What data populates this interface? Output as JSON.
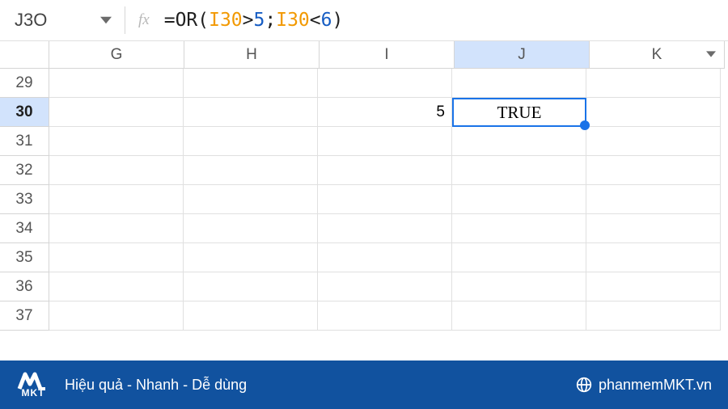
{
  "namebox": {
    "value": "J3O"
  },
  "formula_parts": {
    "p0": "=OR(",
    "ref1": "I30",
    "p1": ">",
    "num1": "5",
    "p2": ";",
    "ref2": "I30",
    "p3": "<",
    "num2": "6",
    "p4": ")"
  },
  "columns": [
    "G",
    "H",
    "I",
    "J",
    "K"
  ],
  "rows": [
    "29",
    "30",
    "31",
    "32",
    "33",
    "34",
    "35",
    "36",
    "37"
  ],
  "selected_col": "J",
  "selected_row": "30",
  "cells": {
    "I30": "5",
    "J30": "TRUE"
  },
  "footer": {
    "brand": "MKT",
    "tagline": "Hiệu quả - Nhanh  - Dễ dùng",
    "site": "phanmemMKT.vn"
  }
}
